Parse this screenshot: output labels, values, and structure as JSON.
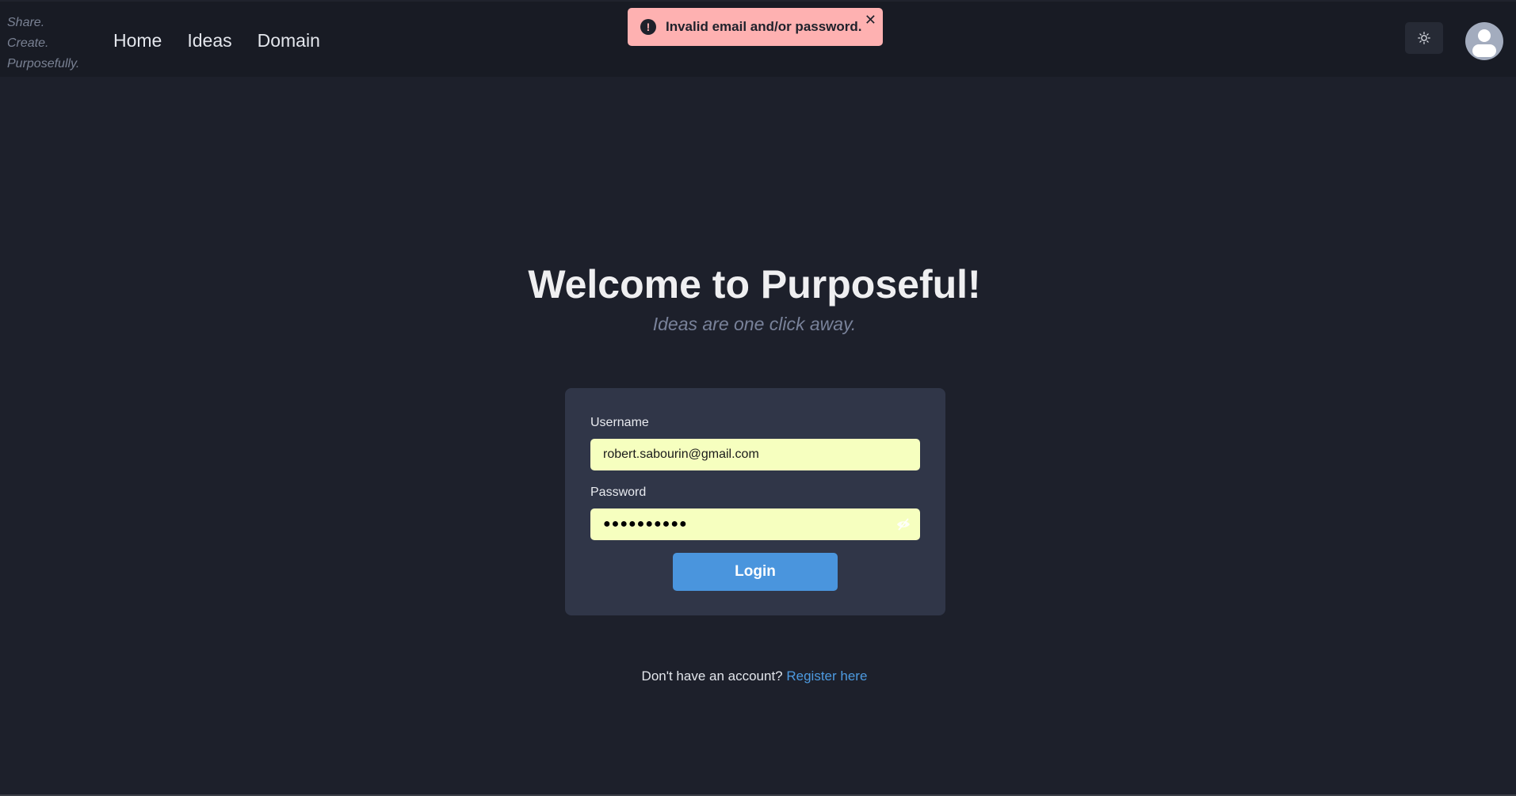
{
  "header": {
    "tagline": [
      "Share.",
      "Create.",
      "Purposefully."
    ],
    "nav": [
      {
        "label": "Home"
      },
      {
        "label": "Ideas"
      },
      {
        "label": "Domain"
      }
    ],
    "theme_toggle_icon": "sun-icon",
    "avatar_icon": "user-avatar-icon"
  },
  "toast": {
    "icon": "exclamation-circle-icon",
    "message": "Invalid email and/or password.",
    "close_icon": "close-icon",
    "close_glyph": "✕",
    "exclamation_glyph": "!",
    "background": "#feb1b1"
  },
  "main": {
    "title": "Welcome to Purposeful!",
    "subtitle": "Ideas are one click away."
  },
  "form": {
    "username_label": "Username",
    "username_value": "robert.sabourin@gmail.com",
    "password_label": "Password",
    "password_masked": "●●●●●●●●●●",
    "password_visibility_icon": "eye-off-icon",
    "login_label": "Login"
  },
  "footer": {
    "prompt": "Don't have an account?",
    "register_link": "Register here"
  },
  "colors": {
    "accent": "#4a95dd",
    "link": "#4d9ae0",
    "input_bg": "#f6ffbf",
    "card_bg": "#303648",
    "page_bg": "#1d202b",
    "header_bg": "#181b24"
  }
}
